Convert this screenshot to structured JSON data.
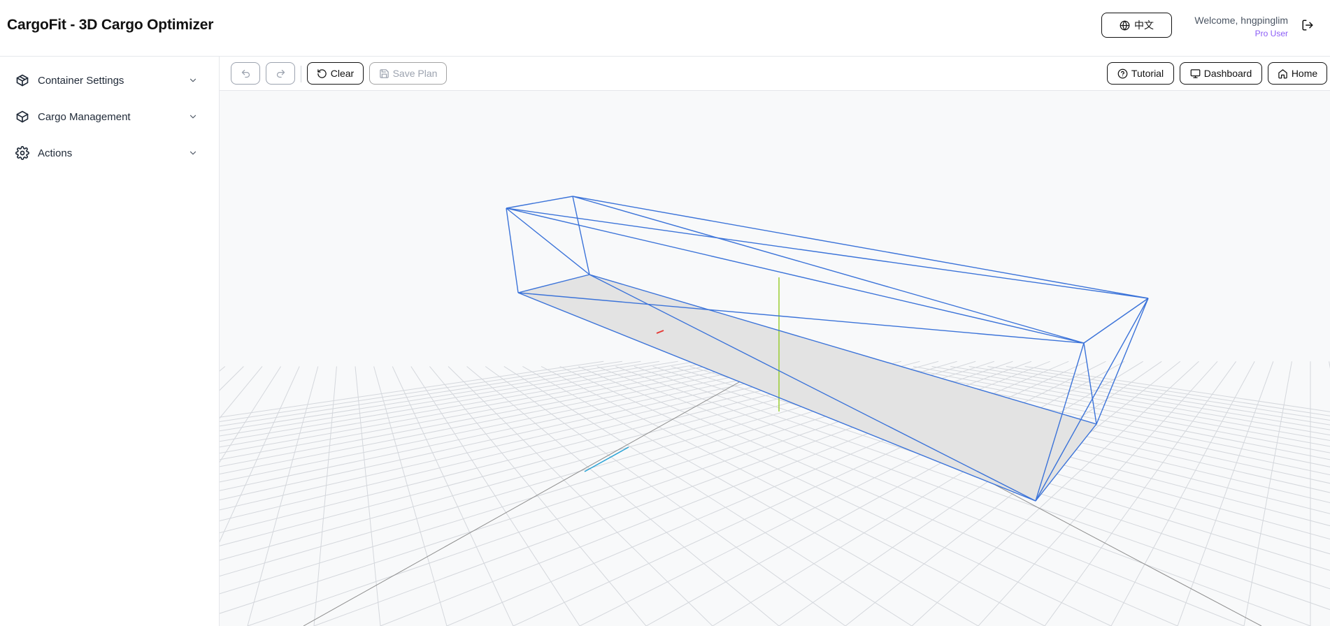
{
  "header": {
    "title": "CargoFit - 3D Cargo Optimizer",
    "language_label": "中文",
    "welcome": "Welcome, hngpinglim",
    "user_tier": "Pro User"
  },
  "sidebar": {
    "items": [
      {
        "label": "Container Settings",
        "icon": "container-icon"
      },
      {
        "label": "Cargo Management",
        "icon": "package-icon"
      },
      {
        "label": "Actions",
        "icon": "gear-icon"
      }
    ]
  },
  "toolbar": {
    "clear_label": "Clear",
    "save_label": "Save Plan",
    "tutorial_label": "Tutorial",
    "dashboard_label": "Dashboard",
    "home_label": "Home"
  },
  "colors": {
    "accent": "#8b5cf6",
    "wireframe": "#3b73d9",
    "grid": "#d4d7dc",
    "y_axis": "#9acd32",
    "x_axis": "#e53935",
    "z_axis": "#29a3d6",
    "floor": "#e3e3e3"
  }
}
